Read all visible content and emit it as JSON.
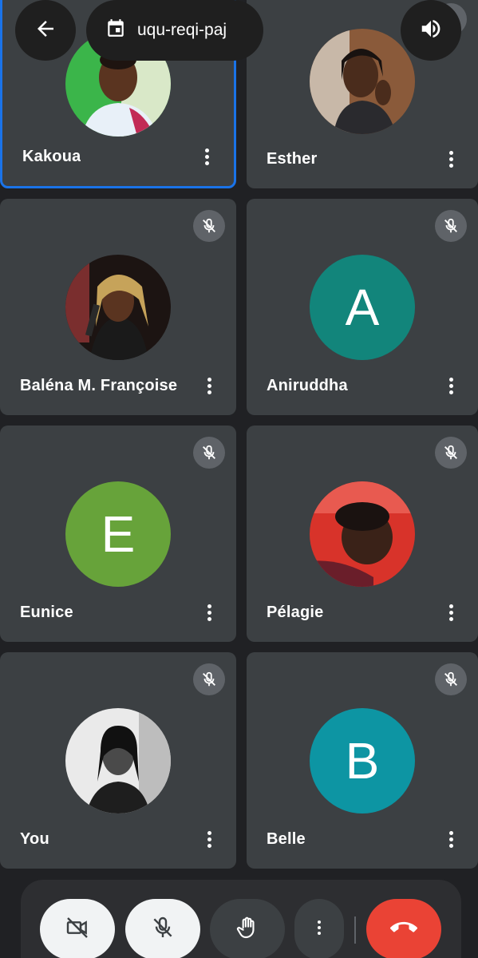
{
  "header": {
    "meeting_code": "uqu-reqi-paj",
    "back_icon": "arrow-back-icon",
    "calendar_icon": "calendar-icon",
    "speaker_icon": "volume-icon"
  },
  "participants": [
    {
      "name": "Kakoua",
      "avatar": "photo",
      "active": true,
      "muted": false
    },
    {
      "name": "Esther",
      "avatar": "photo",
      "active": false,
      "muted": true
    },
    {
      "name": "Baléna M. Françoise",
      "avatar": "photo",
      "active": false,
      "muted": true
    },
    {
      "name": "Aniruddha",
      "avatar": "letter",
      "letter": "A",
      "color": "#12857b",
      "muted": true
    },
    {
      "name": "Eunice",
      "avatar": "letter",
      "letter": "E",
      "color": "#67a33a",
      "muted": true
    },
    {
      "name": "Pélagie",
      "avatar": "photo",
      "active": false,
      "muted": true
    },
    {
      "name": "You",
      "avatar": "photo",
      "active": false,
      "muted": true
    },
    {
      "name": "Belle",
      "avatar": "letter",
      "letter": "B",
      "color": "#0d95a3",
      "muted": true
    }
  ],
  "controls": [
    {
      "name": "camera-off-button",
      "icon": "videocam-off-icon"
    },
    {
      "name": "mic-off-button",
      "icon": "mic-off-icon"
    },
    {
      "name": "raise-hand-button",
      "icon": "hand-icon"
    },
    {
      "name": "more-options-button",
      "icon": "more-vert-icon"
    },
    {
      "name": "end-call-button",
      "icon": "call-end-icon"
    }
  ],
  "colors": {
    "background": "#202124",
    "tile": "#3c4043",
    "active_border": "#1a73e8",
    "end_call": "#ea4335"
  }
}
